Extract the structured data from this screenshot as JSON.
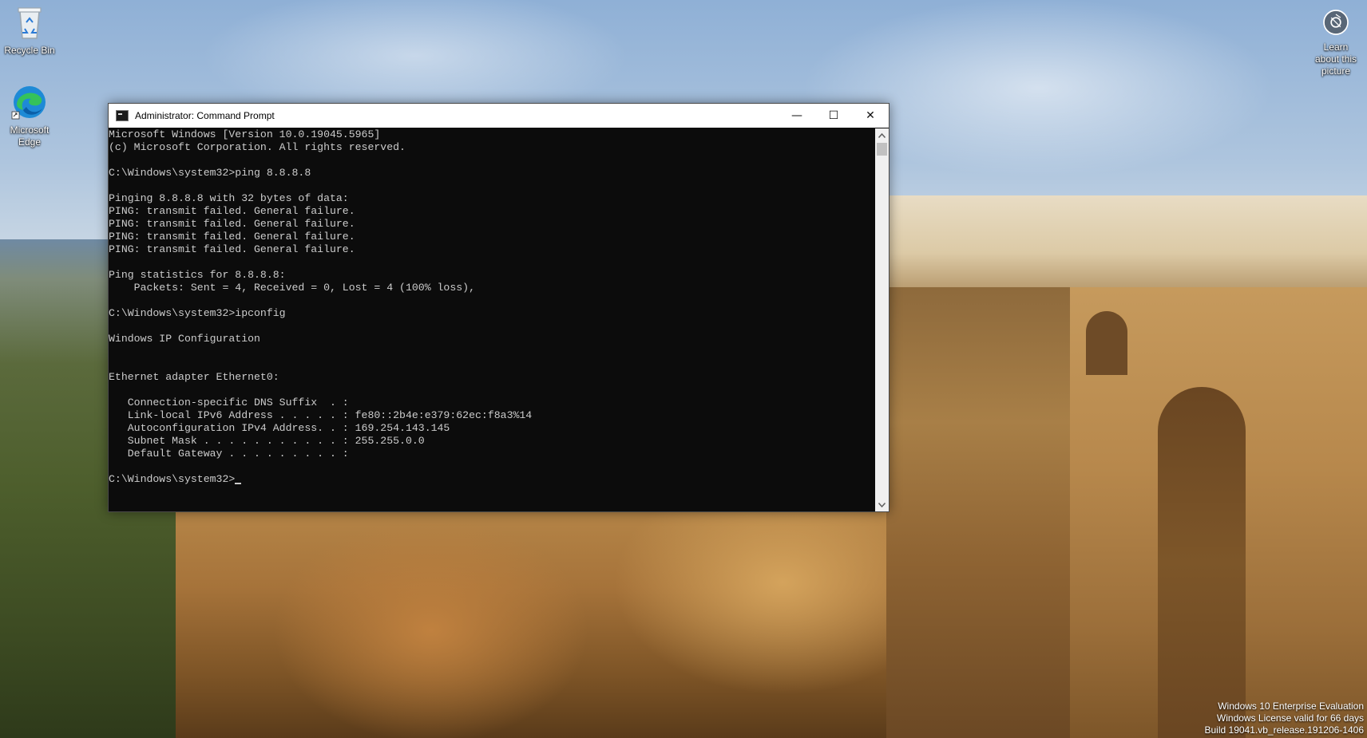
{
  "desktop": {
    "icons": [
      {
        "label": "Recycle Bin",
        "icon": "recycle-bin-icon"
      },
      {
        "label": "Microsoft Edge",
        "icon": "edge-icon"
      }
    ],
    "spotlight": {
      "label": "Learn about this picture",
      "icon": "camera-icon"
    }
  },
  "cmd": {
    "title": "Administrator: Command Prompt",
    "buttons": {
      "minimize": "—",
      "maximize": "☐",
      "close": "✕"
    },
    "lines": [
      "Microsoft Windows [Version 10.0.19045.5965]",
      "(c) Microsoft Corporation. All rights reserved.",
      "",
      "C:\\Windows\\system32>ping 8.8.8.8",
      "",
      "Pinging 8.8.8.8 with 32 bytes of data:",
      "PING: transmit failed. General failure.",
      "PING: transmit failed. General failure.",
      "PING: transmit failed. General failure.",
      "PING: transmit failed. General failure.",
      "",
      "Ping statistics for 8.8.8.8:",
      "    Packets: Sent = 4, Received = 0, Lost = 4 (100% loss),",
      "",
      "C:\\Windows\\system32>ipconfig",
      "",
      "Windows IP Configuration",
      "",
      "",
      "Ethernet adapter Ethernet0:",
      "",
      "   Connection-specific DNS Suffix  . :",
      "   Link-local IPv6 Address . . . . . : fe80::2b4e:e379:62ec:f8a3%14",
      "   Autoconfiguration IPv4 Address. . : 169.254.143.145",
      "   Subnet Mask . . . . . . . . . . . : 255.255.0.0",
      "   Default Gateway . . . . . . . . . :",
      ""
    ],
    "prompt": "C:\\Windows\\system32>"
  },
  "watermark": {
    "line1": "Windows 10 Enterprise Evaluation",
    "line2": "Windows License valid for 66 days",
    "line3": "Build 19041.vb_release.191206-1406"
  }
}
